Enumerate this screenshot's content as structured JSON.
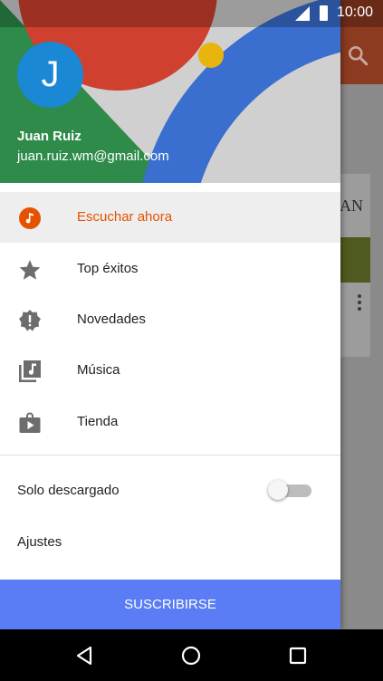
{
  "status_bar": {
    "time": "10:00"
  },
  "drawer": {
    "avatar_letter": "J",
    "account_name": "Juan Ruiz",
    "account_email": "juan.ruiz.wm@gmail.com",
    "items": [
      {
        "label": "Escuchar ahora",
        "icon": "listen-now-icon",
        "active": true
      },
      {
        "label": "Top éxitos",
        "icon": "star-icon",
        "active": false
      },
      {
        "label": "Novedades",
        "icon": "new-releases-icon",
        "active": false
      },
      {
        "label": "Música",
        "icon": "music-library-icon",
        "active": false
      },
      {
        "label": "Tienda",
        "icon": "shop-icon",
        "active": false
      }
    ],
    "settings": {
      "download_only_label": "Solo descargado",
      "download_only_on": false,
      "settings_label": "Ajustes"
    },
    "subscribe_label": "SUSCRIBIRSE"
  },
  "background": {
    "card_text": "AN"
  },
  "colors": {
    "accent": "#e65100",
    "subscribe": "#5a7cf5",
    "avatar": "#1a88d4"
  }
}
